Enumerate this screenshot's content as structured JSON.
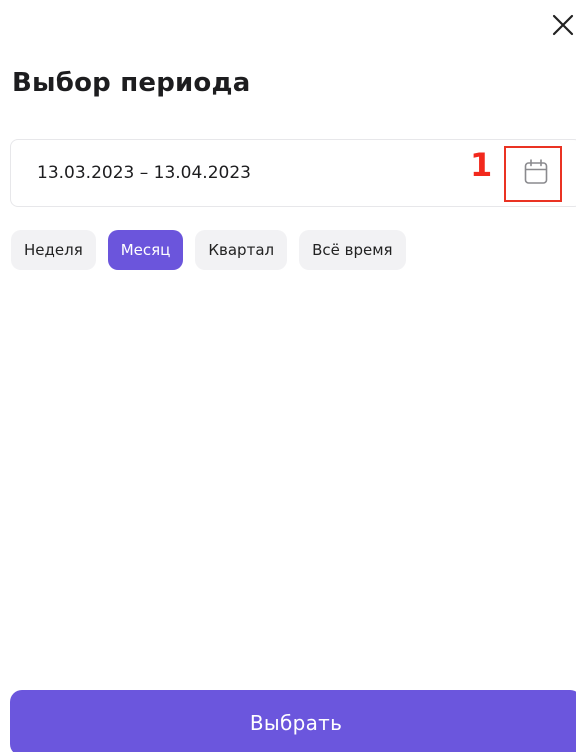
{
  "dialog": {
    "title": "Выбор периода",
    "close_icon": "close-icon"
  },
  "date_range": {
    "value": "13.03.2023 – 13.04.2023",
    "calendar_icon": "calendar-icon"
  },
  "annotation": {
    "number": "1",
    "color": "#ea3323"
  },
  "period_chips": [
    {
      "label": "Неделя",
      "selected": false
    },
    {
      "label": "Месяц",
      "selected": true
    },
    {
      "label": "Квартал",
      "selected": false
    },
    {
      "label": "Всё время",
      "selected": false
    }
  ],
  "submit": {
    "label": "Выбрать"
  },
  "colors": {
    "accent": "#6b56dd",
    "chip_bg": "#f2f2f4",
    "annotation": "#ea3323"
  }
}
